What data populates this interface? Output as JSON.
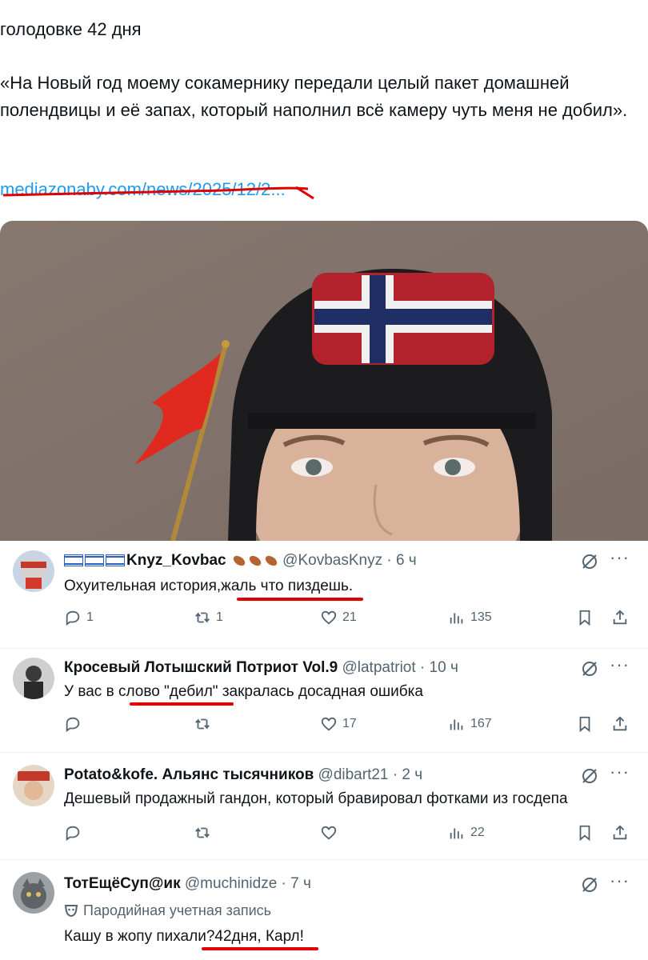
{
  "tweet": {
    "line1": "голодовке 42 дня",
    "quote": "«На Новый год моему сокамернику передали целый пакет домашней полендвицы и её запах, который наполнил всё камеру чуть меня не добил».",
    "link": "mediazonaby.com/news/2025/12/2..."
  },
  "replies": [
    {
      "name": "Knyz_Kovbac",
      "handle": "@KovbasKnyz · 6 ч",
      "text": "Охуительная история,жаль что пиздешь.",
      "stats": {
        "reply": "1",
        "retweet": "1",
        "like": "21",
        "views": "135"
      }
    },
    {
      "name": "Кросевый Лотышский Потриот Vol.9",
      "handle": "@latpatriot · 10 ч",
      "text": "У вас в слово \"дебил\" закралась досадная ошибка",
      "stats": {
        "reply": "",
        "retweet": "",
        "like": "17",
        "views": "167"
      }
    },
    {
      "name": "Potato&kofe. Альянс тысячников",
      "handle": "@dibart21 · 2 ч",
      "text": "Дешевый продажный гандон, который бравировал фотками из госдепа",
      "stats": {
        "reply": "",
        "retweet": "",
        "like": "",
        "views": "22"
      }
    },
    {
      "name": "ТотЕщёСуп@ик",
      "handle": "@muchinidze · 7 ч",
      "parody": "Пародийная учетная запись",
      "text": "Кашу в жопу пихали?42дня, Карл!"
    }
  ],
  "more_label": "···",
  "colors": {
    "accent": "#1d9bf0",
    "muted": "#536471",
    "underline": "#e00000"
  }
}
